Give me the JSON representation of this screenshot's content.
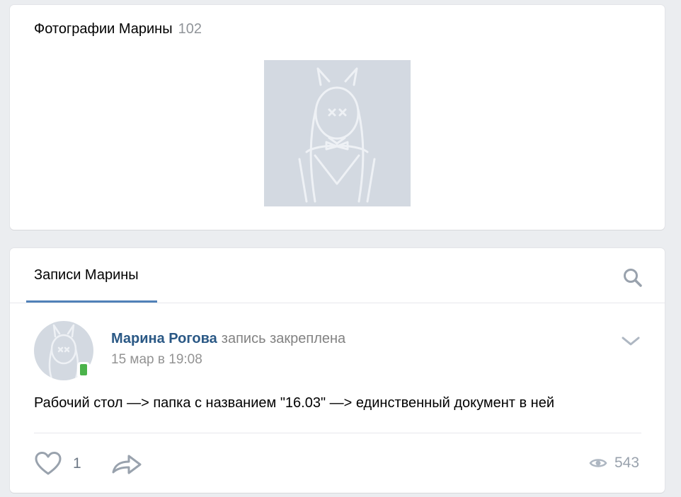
{
  "photos": {
    "title": "Фотографии Марины",
    "count": "102"
  },
  "wall": {
    "tab_label": "Записи Марины",
    "post": {
      "author": "Марина Рогова",
      "action": "запись закреплена",
      "date": "15 мар в 19:08",
      "text": "Рабочий стол —> папка с названием \"16.03\" —> единственный документ в ней",
      "likes": "1",
      "views": "543"
    }
  },
  "colors": {
    "link": "#2a5885",
    "accent": "#5181b8",
    "online": "#4bb34b",
    "muted": "#99a2ad"
  },
  "icons": [
    "search-icon",
    "chevron-down-icon",
    "heart-icon",
    "share-arrow-icon",
    "eye-icon",
    "mobile-online-icon"
  ]
}
